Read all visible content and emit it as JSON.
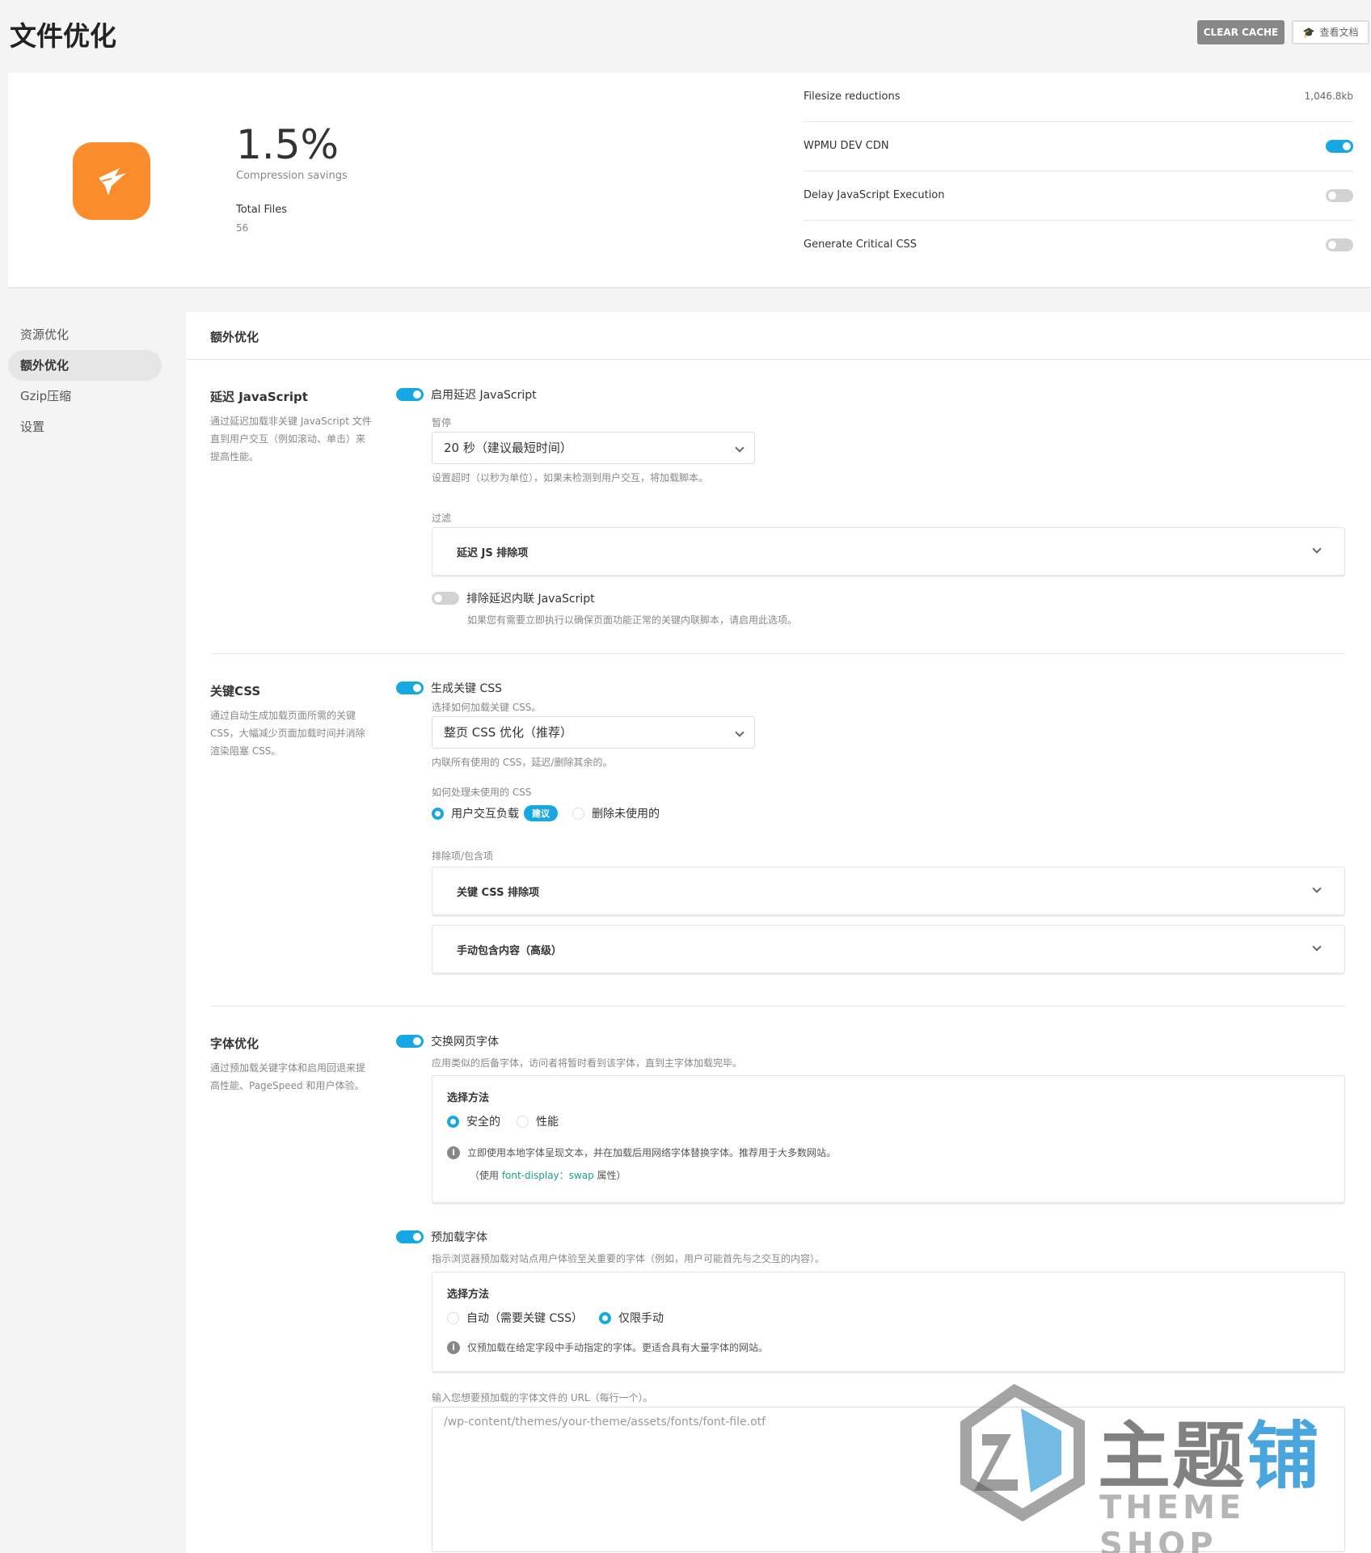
{
  "header": {
    "title": "文件优化",
    "clear_cache": "CLEAR CACHE",
    "docs": "查看文档"
  },
  "summary": {
    "savings_value": "1.5%",
    "savings_label": "Compression savings",
    "total_files_label": "Total Files",
    "total_files_value": "56",
    "rows": [
      {
        "label": "Filesize reductions",
        "value": "1,046.8kb"
      },
      {
        "label": "WPMU DEV CDN",
        "enabled": true
      },
      {
        "label": "Delay JavaScript Execution",
        "enabled": false
      },
      {
        "label": "Generate Critical CSS",
        "enabled": false
      }
    ]
  },
  "sidebar": {
    "items": [
      {
        "label": "资源优化",
        "active": false
      },
      {
        "label": "额外优化",
        "active": true
      },
      {
        "label": "Gzip压缩",
        "active": false
      },
      {
        "label": "设置",
        "active": false
      }
    ]
  },
  "main": {
    "title": "额外优化",
    "delay_js": {
      "title": "延迟 JavaScript",
      "desc": "通过延迟加载非关键 JavaScript 文件直到用户交互（例如滚动、单击）来提高性能。",
      "toggle_label": "启用延迟 JavaScript",
      "toggle_on": true,
      "timeout_label": "暂停",
      "timeout_value": "20 秒（建议最短时间）",
      "timeout_help": "设置超时（以秒为单位），如果未检测到用户交互，将加载脚本。",
      "filter_label": "过滤",
      "filter_accordion": "延迟 JS 排除项",
      "inline_toggle_label": "排除延迟内联 JavaScript",
      "inline_toggle_on": false,
      "inline_help": "如果您有需要立即执行以确保页面功能正常的关键内联脚本，请启用此选项。"
    },
    "critical_css": {
      "title": "关键CSS",
      "desc": "通过自动生成加载页面所需的关键 CSS，大幅减少页面加载时间并消除渲染阻塞 CSS。",
      "toggle_label": "生成关键 CSS",
      "toggle_on": true,
      "select_label": "选择如何加载关键 CSS。",
      "select_value": "整页 CSS 优化（推荐）",
      "select_help": "内联所有使用的 CSS，延迟/删除其余的。",
      "unused_label": "如何处理未使用的 CSS",
      "unused_options": [
        {
          "label": "用户交互负载",
          "selected": true,
          "badge": "建议"
        },
        {
          "label": "删除未使用的",
          "selected": false
        }
      ],
      "exclusions_label": "排除项/包含项",
      "accordion_exclude": "关键 CSS 排除项",
      "accordion_manual": "手动包含内容（高级）"
    },
    "fonts": {
      "title": "字体优化",
      "desc": "通过预加载关键字体和启用回退来提高性能、PageSpeed 和用户体验。",
      "swap_toggle_label": "交换网页字体",
      "swap_toggle_on": true,
      "swap_help": "应用类似的后备字体，访问者将暂时看到该字体，直到主字体加载完毕。",
      "swap_panel": {
        "heading": "选择方法",
        "options": [
          {
            "label": "安全的",
            "selected": true
          },
          {
            "label": "性能",
            "selected": false
          }
        ],
        "info": "立即使用本地字体呈现文本，并在加载后用网络字体替换字体。推荐用于大多数网站。",
        "info2_prefix": "（使用 ",
        "info2_code": "font-display：swap",
        "info2_suffix": " 属性）"
      },
      "preload_toggle_label": "预加载字体",
      "preload_toggle_on": true,
      "preload_help": "指示浏览器预加载对站点用户体验至关重要的字体（例如，用户可能首先与之交互的内容）。",
      "preload_panel": {
        "heading": "选择方法",
        "options": [
          {
            "label": "自动（需要关键 CSS）",
            "selected": false
          },
          {
            "label": "仅限手动",
            "selected": true
          }
        ],
        "info": "仅预加载在给定字段中手动指定的字体。更适合具有大量字体的网站。"
      },
      "url_label": "输入您想要预加载的字体文件的 URL（每行一个）。",
      "url_placeholder": "/wp-content/themes/your-theme/assets/fonts/font-file.otf"
    }
  },
  "watermark": {
    "cn_gray": "主题",
    "cn_blue": "铺",
    "en": "THEME SHOP"
  }
}
